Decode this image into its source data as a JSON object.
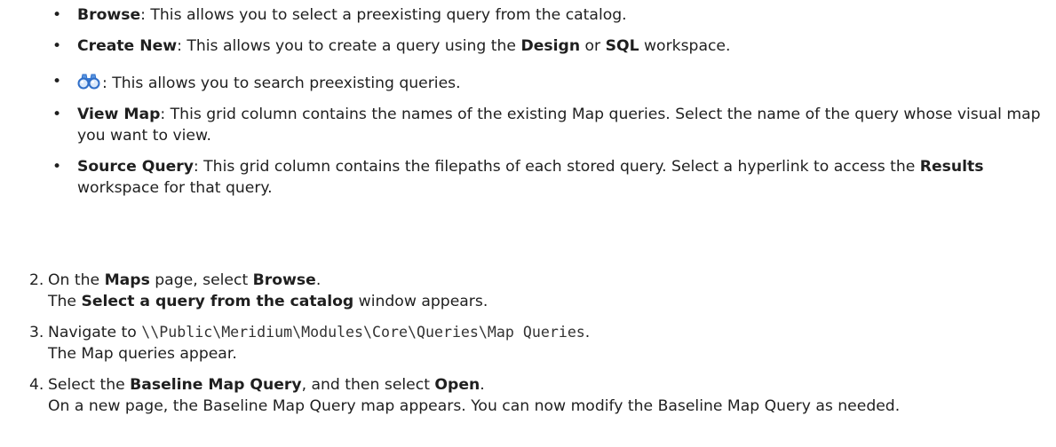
{
  "bullets": [
    {
      "term": "Browse",
      "text": ": This allows you to select a preexisting query from the catalog."
    },
    {
      "term": "Create New",
      "text_a": ": This allows you to create a query using the ",
      "b1": "Design",
      "text_b": " or ",
      "b2": "SQL",
      "text_c": " workspace."
    },
    {
      "icon": "binoculars-search-icon",
      "text": ": This allows you to search preexisting queries."
    },
    {
      "term": "View Map",
      "text": ": This grid column contains the names of the existing Map queries. Select the name of the query whose visual map you want to view."
    },
    {
      "term": "Source Query",
      "text_a": ": This grid column contains the filepaths of each stored query. Select a hyperlink to access the ",
      "b1": "Results",
      "text_b": " workspace for that query."
    }
  ],
  "steps": [
    {
      "num": "2.",
      "a": "On the ",
      "b1": "Maps",
      "c": " page, select ",
      "b2": "Browse",
      "d": ".",
      "line2_pre": "The ",
      "line2_b": "Select a query from the catalog",
      "line2_post": " window appears."
    },
    {
      "num": "3.",
      "a": "Navigate to ",
      "path": "\\\\Public\\Meridium\\Modules\\Core\\Queries\\Map Queries",
      "d": ".",
      "line2": "The Map queries appear."
    },
    {
      "num": "4.",
      "a": "Select the ",
      "b1": "Baseline Map Query",
      "c": ", and then select ",
      "b2": "Open",
      "d": ".",
      "line2": "On a new page, the Baseline Map Query map appears. You can now modify the Baseline Map Query as needed."
    }
  ],
  "bullet_glyph": "•",
  "colors": {
    "icon_blue": "#3a7bd5",
    "text": "#1f1f1f"
  }
}
